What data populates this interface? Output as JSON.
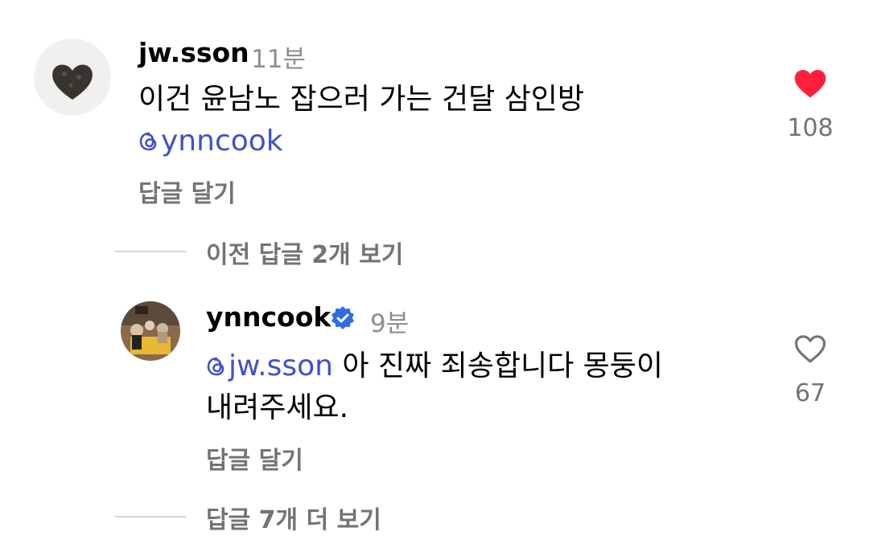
{
  "comments": [
    {
      "username": "jw.sson",
      "time": "11분",
      "text": "이건 윤남노 잡으러 가는 건달 삼인방",
      "mention": "ynncook",
      "reply_label": "답글 달기",
      "like_count": "108",
      "liked": true,
      "avatar_icon": "heart-cookie-icon"
    },
    {
      "username": "ynncook",
      "verified": true,
      "time": "9분",
      "mention": "jw.sson",
      "text_line1": "아 진짜 죄송합니다 몽둥이",
      "text_line2": "내려주세요.",
      "reply_label": "답글 달기",
      "like_count": "67",
      "liked": false
    }
  ],
  "thread": {
    "view_previous": "이전 답글 2개 보기",
    "view_more": "답글 7개 더 보기"
  },
  "colors": {
    "mention": "#3f51c9",
    "like_active": "#ff1f3d",
    "verified": "#2f6be4",
    "muted": "#737373"
  }
}
